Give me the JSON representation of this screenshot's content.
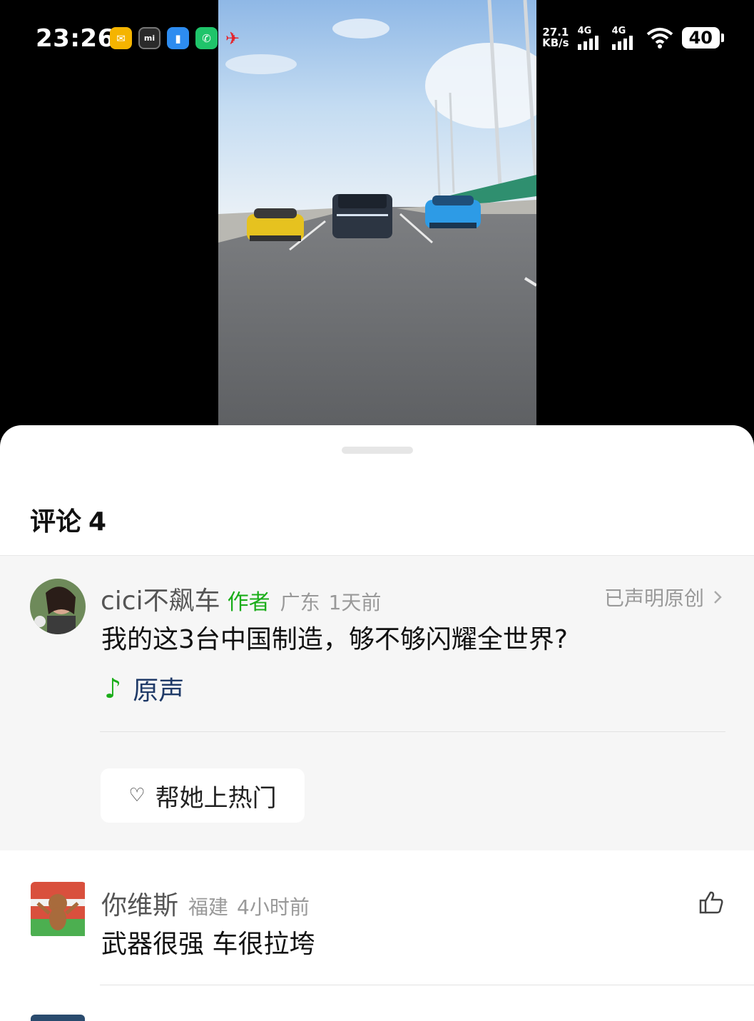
{
  "status_bar": {
    "time": "23:26",
    "notifications": [
      {
        "icon": "mail-icon",
        "glyph": "✉"
      },
      {
        "icon": "mi-icon",
        "glyph": "mi"
      },
      {
        "icon": "document-icon",
        "glyph": "▮"
      },
      {
        "icon": "phone-icon",
        "glyph": "✆"
      },
      {
        "icon": "airline-icon",
        "glyph": "✈"
      }
    ],
    "net_speed_value": "27.1",
    "net_speed_unit": "KB/s",
    "signal_1": "4G",
    "signal_2": "4G",
    "battery": "40"
  },
  "sheet": {
    "title": "评论",
    "count": "4"
  },
  "author_comment": {
    "user": "cici不飙车",
    "tag": "作者",
    "location": "广东",
    "time": "1天前",
    "original_label": "已声明原创",
    "text": "我的这3台中国制造，够不够闪耀全世界?",
    "music_label": "原声",
    "boost_label": "帮她上热门"
  },
  "comments": [
    {
      "user": "你维斯",
      "location": "福建",
      "time": "4小时前",
      "text": "武器很强 车很拉垮"
    }
  ],
  "colors": {
    "accent_green": "#1aad19",
    "music_blue": "#1f3a68"
  }
}
